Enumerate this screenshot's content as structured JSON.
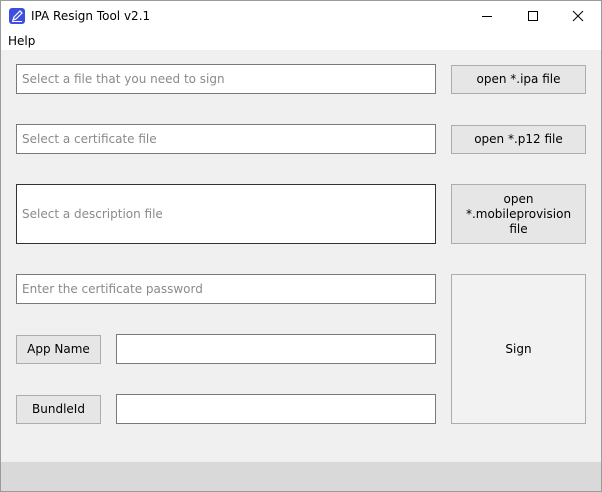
{
  "window": {
    "title": "IPA Resign Tool v2.1"
  },
  "menu": {
    "items": [
      {
        "label": "Help"
      }
    ]
  },
  "form": {
    "ipa_field": {
      "placeholder": "Select a file that you need to sign",
      "value": ""
    },
    "p12_field": {
      "placeholder": "Select a certificate file",
      "value": ""
    },
    "provision_field": {
      "placeholder": "Select a description file",
      "value": ""
    },
    "password_field": {
      "placeholder": "Enter the certificate password",
      "value": ""
    },
    "app_name_label": "App Name",
    "app_name_value": "",
    "bundle_id_label": "BundleId",
    "bundle_id_value": ""
  },
  "buttons": {
    "open_ipa": "open *.ipa file",
    "open_p12": "open *.p12 file",
    "open_provision": "open *.mobileprovision file",
    "sign": "Sign"
  },
  "icons": {
    "app": "pen-icon",
    "minimize": "minimize-icon",
    "maximize": "maximize-icon",
    "close": "close-icon"
  },
  "colors": {
    "app_icon": "#3c4fe0",
    "status_bar": "#d9d9d9"
  }
}
